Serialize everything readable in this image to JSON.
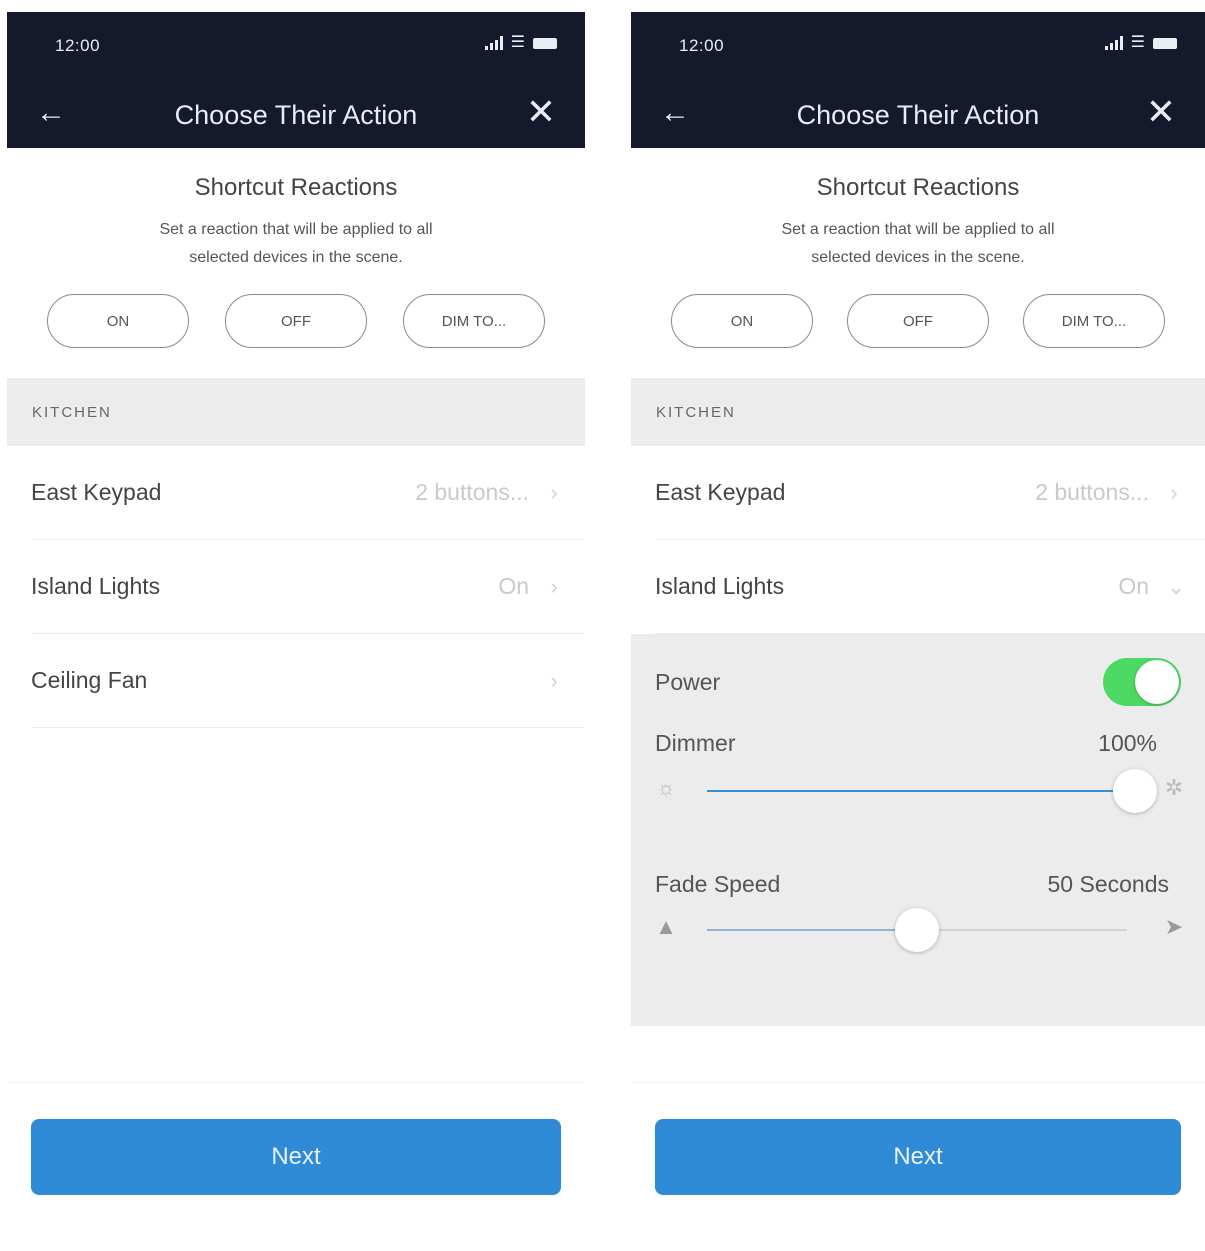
{
  "screens": [
    {
      "status": {
        "time": "12:00"
      },
      "nav": {
        "title": "Choose Their Action",
        "back_icon": "arrow-left-icon",
        "close_icon": "close-icon"
      },
      "shortcut": {
        "title": "Shortcut Reactions",
        "description": "Set a reaction that will be applied to all selected devices in the scene.",
        "buttons": [
          "ON",
          "OFF",
          "DIM TO..."
        ]
      },
      "section": "KITCHEN",
      "devices": [
        {
          "name": "East Keypad",
          "value": "2 buttons..."
        },
        {
          "name": "Island Lights",
          "value": "On"
        },
        {
          "name": "Ceiling Fan",
          "value": ""
        }
      ],
      "next_label": "Next"
    },
    {
      "status": {
        "time": "12:00"
      },
      "nav": {
        "title": "Choose Their Action",
        "back_icon": "arrow-left-icon",
        "close_icon": "close-icon"
      },
      "shortcut": {
        "title": "Shortcut Reactions",
        "description": "Set a reaction that will be applied to all selected devices in the scene.",
        "buttons": [
          "ON",
          "OFF",
          "DIM TO..."
        ]
      },
      "section": "KITCHEN",
      "devices": [
        {
          "name": "East Keypad",
          "value": "2 buttons..."
        },
        {
          "name": "Island Lights",
          "value": "On"
        }
      ],
      "expanded": {
        "power_label": "Power",
        "power_on": true,
        "dimmer_label": "Dimmer",
        "dimmer_value": "100%",
        "dimmer_level": 1.0,
        "fade_label": "Fade Speed",
        "fade_value": "50 Seconds",
        "fade_level": 0.5
      },
      "next_label": "Next"
    }
  ],
  "colors": {
    "header_bg": "#141a2c",
    "accent": "#2f8bd6",
    "toggle_on": "#4cd964"
  }
}
